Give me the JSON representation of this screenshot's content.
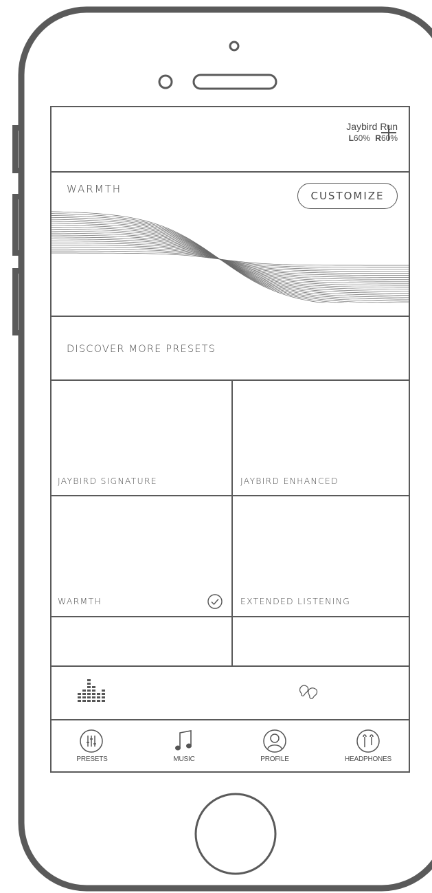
{
  "header": {
    "add_icon": "plus-icon"
  },
  "current_preset": {
    "title": "WARMTH",
    "customize_label": "CUSTOMIZE"
  },
  "discover": {
    "label": "DISCOVER MORE PRESETS"
  },
  "presets": [
    {
      "label": "JAYBIRD SIGNATURE",
      "selected": false
    },
    {
      "label": "JAYBIRD ENHANCED",
      "selected": false
    },
    {
      "label": "WARMTH",
      "selected": true
    },
    {
      "label": "EXTENDED LISTENING",
      "selected": false
    }
  ],
  "status_bar": {
    "eq_icon": "equalizer-icon",
    "device_name": "Jaybird Run",
    "left_label": "L",
    "left_value": "60%",
    "right_label": "R",
    "right_value": "60%"
  },
  "nav": [
    {
      "label": "PRESETS",
      "icon": "sliders-icon"
    },
    {
      "label": "MUSIC",
      "icon": "music-note-icon"
    },
    {
      "label": "PROFILE",
      "icon": "person-icon"
    },
    {
      "label": "HEADPHONES",
      "icon": "earbuds-icon"
    }
  ],
  "colors": {
    "outline": "#5a5a5a",
    "text": "#4a4a4a",
    "background": "#ffffff"
  }
}
